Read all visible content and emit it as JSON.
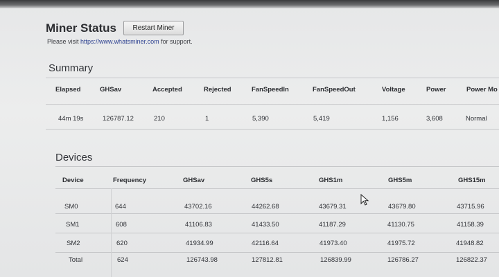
{
  "header": {
    "title": "Miner Status",
    "restart_label": "Restart Miner",
    "support_prefix": "Please visit",
    "support_link": "https://www.whatsminer.com",
    "support_suffix": "for support."
  },
  "summary": {
    "title": "Summary",
    "columns": [
      "Elapsed",
      "GHSav",
      "Accepted",
      "Rejected",
      "FanSpeedIn",
      "FanSpeedOut",
      "Voltage",
      "Power",
      "Power Mo"
    ],
    "row": [
      "44m 19s",
      "126787.12",
      "210",
      "1",
      "5,390",
      "5,419",
      "1,156",
      "3,608",
      "Normal"
    ]
  },
  "devices": {
    "title": "Devices",
    "columns": [
      "Device",
      "Frequency",
      "GHSav",
      "GHS5s",
      "GHS1m",
      "GHS5m",
      "GHS15m"
    ],
    "rows": [
      [
        "SM0",
        "644",
        "43702.16",
        "44262.68",
        "43679.31",
        "43679.80",
        "43715.96"
      ],
      [
        "SM1",
        "608",
        "41106.83",
        "41433.50",
        "41187.29",
        "41130.75",
        "41158.39"
      ],
      [
        "SM2",
        "620",
        "41934.99",
        "42116.64",
        "41973.40",
        "41975.72",
        "41948.82"
      ],
      [
        "Total",
        "624",
        "126743.98",
        "127812.81",
        "126839.99",
        "126786.27",
        "126822.37"
      ]
    ]
  },
  "colors": {
    "link": "#2a3f8f",
    "background": "#e8e9ea"
  },
  "icons": {
    "cursor": "mouse-pointer-icon"
  }
}
